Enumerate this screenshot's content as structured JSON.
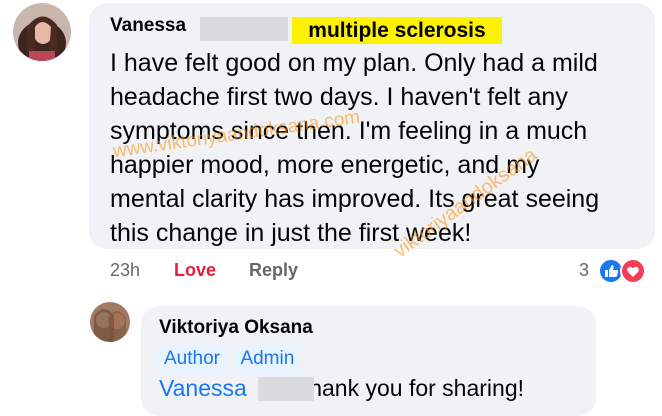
{
  "comment": {
    "author": "Vanessa",
    "condition_tag": "multiple sclerosis",
    "text": "I have felt good on my plan. Only had a mild\nheadache first two days. I haven't felt any\nsymptoms since then. I'm feeling in a much\nhappier mood, more energetic, and my\nmental clarity has improved. Its great seeing\nthis change in just the first week!",
    "time": "23h",
    "love_label": "Love",
    "reply_label": "Reply",
    "reaction_count": "3",
    "reaction_icons": [
      "like-icon",
      "love-icon"
    ]
  },
  "reply": {
    "author": "Viktoriya Oksana",
    "badges": [
      "Author",
      "Admin"
    ],
    "mention": "Vanessa",
    "text": "thank you for sharing!"
  },
  "watermark": "www.viktoriyaandoksana.com",
  "watermark2": "viktoriyaandoksana",
  "colors": {
    "bubble": "#f0f2f5",
    "love": "#e41e3f",
    "link": "#1877f2",
    "highlight": "#fff200"
  }
}
